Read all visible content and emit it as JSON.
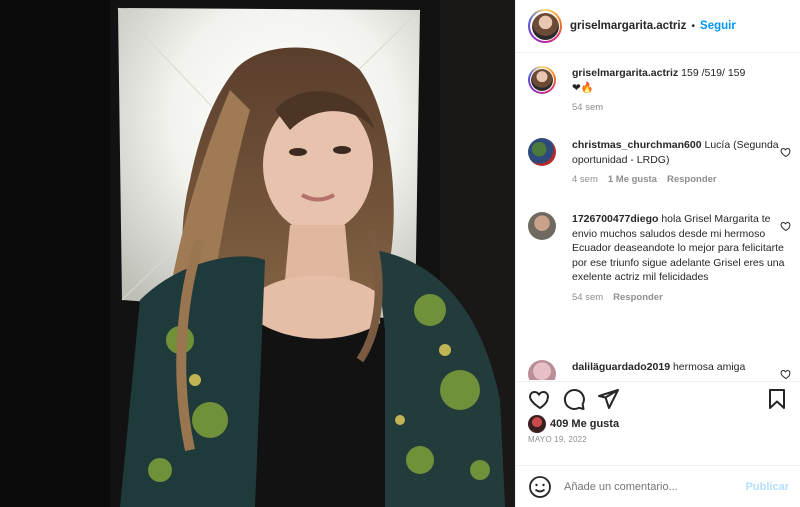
{
  "post_header": {
    "username": "griselmargarita.actriz",
    "separator": "•",
    "follow_label": "Seguir"
  },
  "caption": {
    "username": "griselmargarita.actriz",
    "text": "159 /519/ 159",
    "emoji": "❤🔥",
    "time": "54 sem"
  },
  "comments": [
    {
      "username": "christmas_churchman600",
      "text": "Lucía (Segunda oportunidad - LRDG)",
      "time": "4 sem",
      "likes": "1 Me gusta",
      "reply": "Responder"
    },
    {
      "username": "1726700477diego",
      "text": "hola Grisel Margarita te envio muchos saludos desde mi hermoso Ecuador deaseandote lo mejor para felicitarte por ese triunfo sigue adelante Grisel eres una exelente actriz mil felicidades",
      "time": "54 sem",
      "reply": "Responder"
    },
    {
      "username": "daliläguardado2019",
      "text": "hermosa amiga"
    }
  ],
  "likes_label": "409 Me gusta",
  "date_label": "MAYO 19, 2022",
  "comment_box": {
    "placeholder": "Añade un comentario...",
    "publish_label": "Publicar"
  },
  "icons": {
    "like": "heart-icon",
    "comment": "comment-icon",
    "share": "paper-plane-icon",
    "save": "bookmark-icon",
    "emoji": "smiley-icon"
  },
  "colors": {
    "link_blue": "#0095f6",
    "publish_disabled": "#b2dffc",
    "muted": "#8e8e8e"
  }
}
